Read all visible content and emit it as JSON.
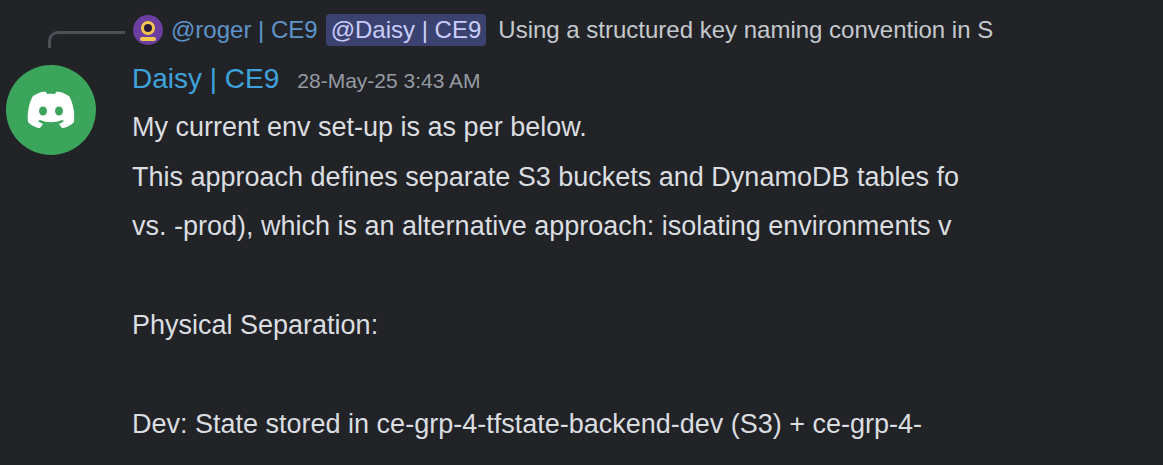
{
  "reply": {
    "author": "@roger | CE9",
    "mention": "@Daisy | CE9",
    "text": "Using a structured key naming convention in S"
  },
  "message": {
    "author": "Daisy | CE9",
    "timestamp": "28-May-25 3:43 AM",
    "lines": [
      "My current env set-up is as per below.",
      "This approach defines separate S3 buckets and DynamoDB tables fo",
      "vs. -prod), which is an alternative approach: isolating environments v",
      "",
      "Physical Separation:",
      "",
      "Dev: State stored in ce-grp-4-tfstate-backend-dev (S3) + ce-grp-4-"
    ]
  }
}
